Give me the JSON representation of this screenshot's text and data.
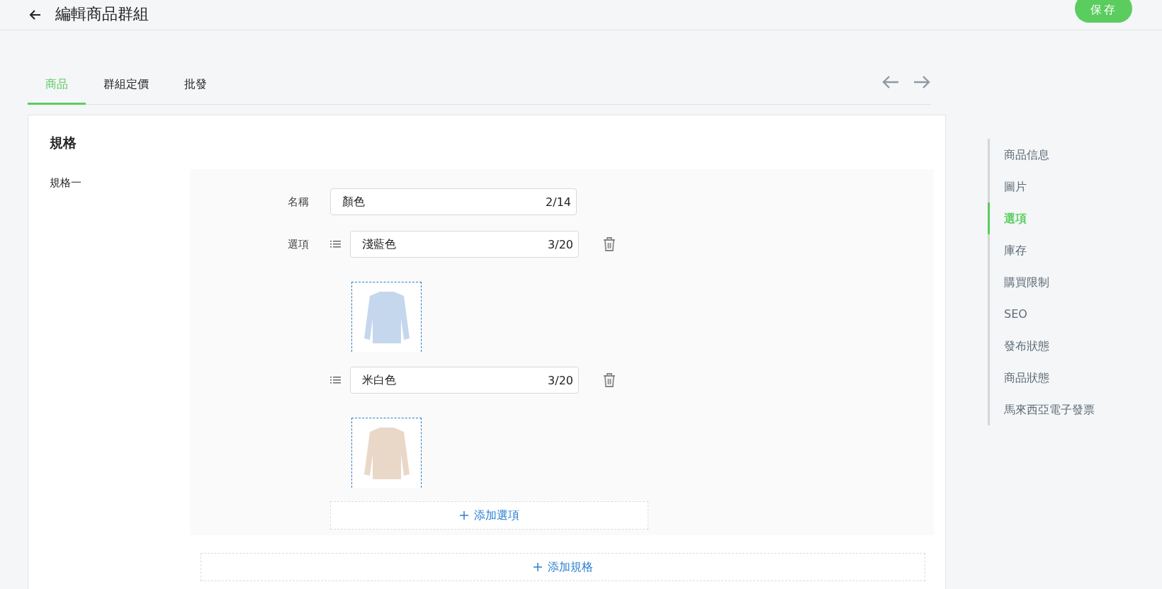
{
  "header": {
    "title": "編輯商品群組",
    "save_button": "保存"
  },
  "tabs": [
    {
      "label": "商品",
      "selected": true
    },
    {
      "label": "群組定價",
      "selected": false
    },
    {
      "label": "批發",
      "selected": false
    }
  ],
  "spec_section": {
    "title": "規格",
    "spec_label": "規格一",
    "name_label": "名稱",
    "name_value": "顏色",
    "name_count": "2/14",
    "options_label": "選項",
    "options": [
      {
        "value": "淺藍色",
        "count": "3/20",
        "color": "#c5d7ec"
      },
      {
        "value": "米白色",
        "count": "3/20",
        "color": "#e9d8c8"
      }
    ],
    "add_option": "添加選項",
    "add_spec": "添加規格"
  },
  "side_nav": [
    {
      "label": "商品信息",
      "selected": false
    },
    {
      "label": "圖片",
      "selected": false
    },
    {
      "label": "選項",
      "selected": true
    },
    {
      "label": "庫存",
      "selected": false
    },
    {
      "label": "購買限制",
      "selected": false
    },
    {
      "label": "SEO",
      "selected": false
    },
    {
      "label": "發布狀態",
      "selected": false
    },
    {
      "label": "商品狀態",
      "selected": false
    },
    {
      "label": "馬來西亞電子發票",
      "selected": false
    }
  ]
}
